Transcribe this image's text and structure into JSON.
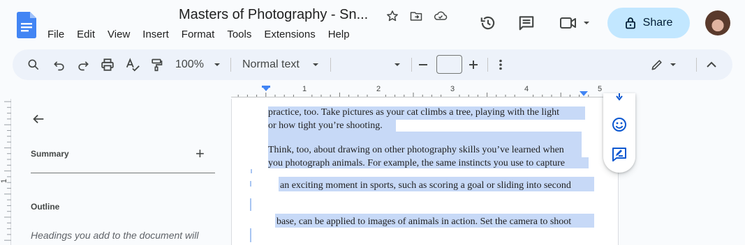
{
  "app": {
    "title": "Masters of Photography - Sn...",
    "menu": [
      "File",
      "Edit",
      "View",
      "Insert",
      "Format",
      "Tools",
      "Extensions",
      "Help"
    ],
    "share_label": "Share",
    "icons": [
      "star-icon",
      "move-to-folder-icon",
      "cloud-saved-icon",
      "history-icon",
      "comments-icon",
      "meet-video-icon",
      "lock-icon"
    ]
  },
  "toolbar": {
    "zoom": "100%",
    "style": "Normal text",
    "font": "",
    "font_size": ""
  },
  "ruler": {
    "numbers": [
      "1",
      "2",
      "3",
      "4",
      "5"
    ],
    "vertical_number": "1"
  },
  "outline_panel": {
    "summary_label": "Summary",
    "add_label": "+",
    "outline_label": "Outline",
    "hint": "Headings you add to the document will"
  },
  "document": {
    "lines": [
      "practice, too. Take pictures as your cat climbs  a tree, playing with the light",
      "or how tight you’re shooting.",
      "Think, too, about drawing on other photography skills you’ve learned when",
      "you photograph animals. For example, the same instincts you use to capture",
      "an exciting moment in sports, such as scoring a goal or sliding into second",
      "base, can be applied to images of animals in action. Set the camera to shoot"
    ]
  },
  "colors": {
    "accent": "#c2e7ff",
    "selection": "#c7d9f7",
    "toolbar_bg": "#edf2fa",
    "doc_blue": "#4285f4"
  }
}
